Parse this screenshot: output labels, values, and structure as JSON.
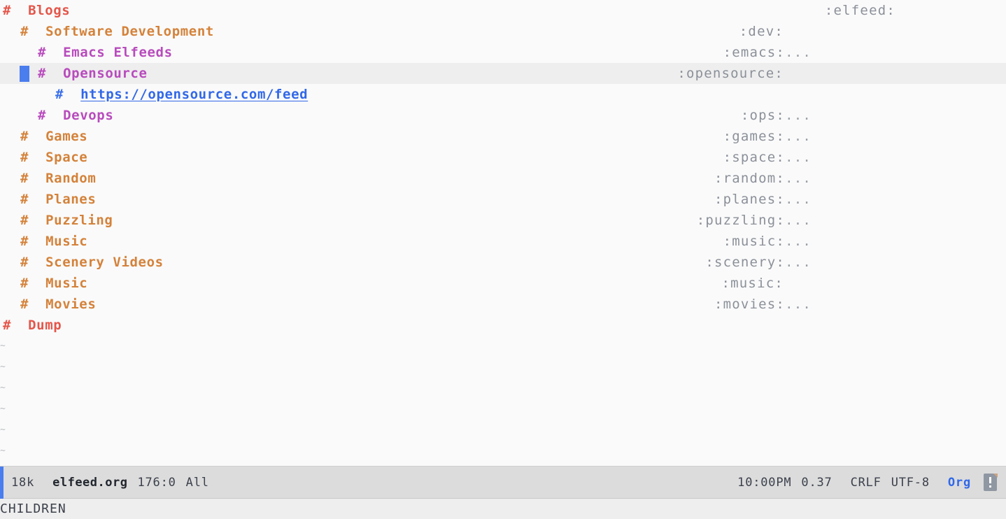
{
  "buffer": {
    "background": "#fafafa",
    "highlight": "#eeeeee",
    "rows": [
      {
        "indent": 0,
        "bullet": "#",
        "level": 1,
        "text": "Blogs",
        "tag": ":elfeed:",
        "ellipsis": "",
        "tag_right": 158,
        "current": false,
        "link": false
      },
      {
        "indent": 1,
        "bullet": "#",
        "level": 2,
        "text": "Software Development",
        "tag": ":dev:",
        "ellipsis": "",
        "tag_right": 318,
        "current": false,
        "link": false
      },
      {
        "indent": 2,
        "bullet": "#",
        "level": 3,
        "text": "Emacs Elfeeds",
        "tag": ":emacs:",
        "ellipsis": "...",
        "tag_right": 278,
        "current": false,
        "link": false
      },
      {
        "indent": 2,
        "bullet": "#",
        "level": 3,
        "text": "Opensource",
        "tag": ":opensource:",
        "ellipsis": "",
        "tag_right": 318,
        "current": true,
        "link": false
      },
      {
        "indent": 3,
        "bullet": "#",
        "level": 4,
        "text": "https://opensource.com/feed",
        "tag": "",
        "ellipsis": "",
        "tag_right": 278,
        "current": false,
        "link": true
      },
      {
        "indent": 2,
        "bullet": "#",
        "level": 3,
        "text": "Devops",
        "tag": ":ops:",
        "ellipsis": "...",
        "tag_right": 278,
        "current": false,
        "link": false
      },
      {
        "indent": 1,
        "bullet": "#",
        "level": 2,
        "text": "Games",
        "tag": ":games:",
        "ellipsis": "...",
        "tag_right": 278,
        "current": false,
        "link": false
      },
      {
        "indent": 1,
        "bullet": "#",
        "level": 2,
        "text": "Space",
        "tag": ":space:",
        "ellipsis": "...",
        "tag_right": 278,
        "current": false,
        "link": false
      },
      {
        "indent": 1,
        "bullet": "#",
        "level": 2,
        "text": "Random",
        "tag": ":random:",
        "ellipsis": "...",
        "tag_right": 278,
        "current": false,
        "link": false
      },
      {
        "indent": 1,
        "bullet": "#",
        "level": 2,
        "text": "Planes",
        "tag": ":planes:",
        "ellipsis": "...",
        "tag_right": 278,
        "current": false,
        "link": false
      },
      {
        "indent": 1,
        "bullet": "#",
        "level": 2,
        "text": "Puzzling",
        "tag": ":puzzling:",
        "ellipsis": "...",
        "tag_right": 278,
        "current": false,
        "link": false
      },
      {
        "indent": 1,
        "bullet": "#",
        "level": 2,
        "text": "Music",
        "tag": ":music:",
        "ellipsis": "...",
        "tag_right": 278,
        "current": false,
        "link": false
      },
      {
        "indent": 1,
        "bullet": "#",
        "level": 2,
        "text": "Scenery Videos",
        "tag": ":scenery:",
        "ellipsis": "...",
        "tag_right": 278,
        "current": false,
        "link": false
      },
      {
        "indent": 1,
        "bullet": "#",
        "level": 2,
        "text": "Music",
        "tag": ":music:",
        "ellipsis": "",
        "tag_right": 318,
        "current": false,
        "link": false
      },
      {
        "indent": 1,
        "bullet": "#",
        "level": 2,
        "text": "Movies",
        "tag": ":movies:",
        "ellipsis": "...",
        "tag_right": 278,
        "current": false,
        "link": false
      },
      {
        "indent": 0,
        "bullet": "#",
        "level": 1,
        "text": "Dump",
        "tag": "",
        "ellipsis": "",
        "tag_right": 278,
        "current": false,
        "link": false
      }
    ],
    "empty_line_marker": "~",
    "empty_line_count": 6,
    "heading_colors": {
      "level1": "#e4564a",
      "level2": "#d4823a",
      "level3": "#b84bbd",
      "level4": "#3a6fe8"
    },
    "tag_color": "#8b9099",
    "cursor_color": "#4a7dee"
  },
  "modeline": {
    "accent_color": "#4a7dee",
    "background": "#dcdcdc",
    "size": "18k",
    "buffer_name": "elfeed.org",
    "position": "176:0",
    "scroll": "All",
    "time": "10:00PM",
    "load": "0.37",
    "eol": "CRLF",
    "encoding": "UTF-8",
    "major_mode": "Org",
    "status_icon": "document-warning-icon"
  },
  "echo_area": {
    "message": "CHILDREN"
  }
}
